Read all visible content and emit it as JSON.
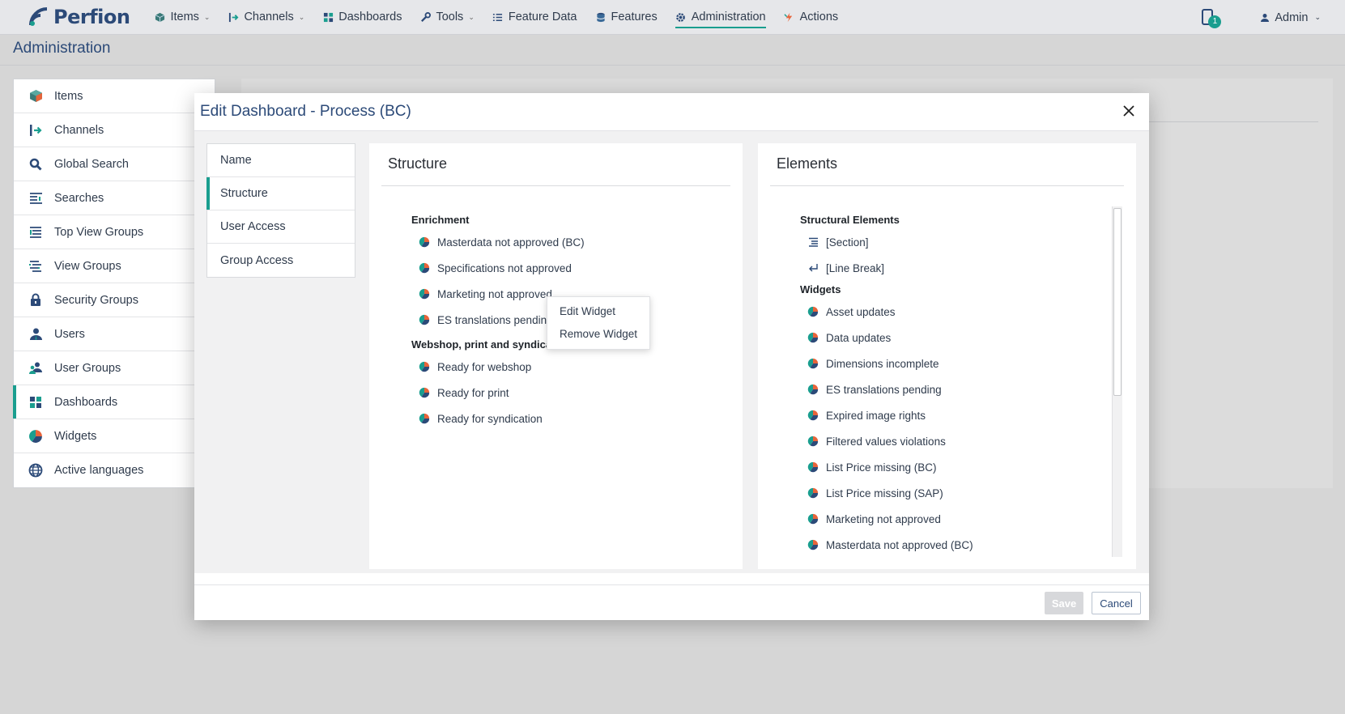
{
  "app": {
    "brand": "Perfion",
    "nav": [
      {
        "label": "Items",
        "icon": "cube-icon",
        "caret": true
      },
      {
        "label": "Channels",
        "icon": "channel-icon",
        "caret": true
      },
      {
        "label": "Dashboards",
        "icon": "dashboard-icon",
        "caret": false
      },
      {
        "label": "Tools",
        "icon": "wrench-icon",
        "caret": true
      },
      {
        "label": "Feature Data",
        "icon": "list-icon",
        "caret": false
      },
      {
        "label": "Features",
        "icon": "database-icon",
        "caret": false
      },
      {
        "label": "Administration",
        "icon": "gear-icon",
        "caret": false,
        "active": true
      },
      {
        "label": "Actions",
        "icon": "lightning-icon",
        "caret": false
      }
    ],
    "notification_count": "1",
    "user_label": "Admin"
  },
  "page": {
    "title": "Administration"
  },
  "sidebar": {
    "items": [
      {
        "label": "Items",
        "icon": "cube-icon"
      },
      {
        "label": "Channels",
        "icon": "channel-icon"
      },
      {
        "label": "Global Search",
        "icon": "search-icon"
      },
      {
        "label": "Searches",
        "icon": "searches-icon"
      },
      {
        "label": "Top View Groups",
        "icon": "top-view-groups-icon"
      },
      {
        "label": "View Groups",
        "icon": "view-groups-icon"
      },
      {
        "label": "Security Groups",
        "icon": "lock-icon"
      },
      {
        "label": "Users",
        "icon": "user-icon"
      },
      {
        "label": "User Groups",
        "icon": "user-group-icon"
      },
      {
        "label": "Dashboards",
        "icon": "dashboard-icon",
        "active": true
      },
      {
        "label": "Widgets",
        "icon": "pie-chart-icon"
      },
      {
        "label": "Active languages",
        "icon": "globe-icon"
      }
    ]
  },
  "modal": {
    "title": "Edit Dashboard - Process (BC)",
    "tabs": [
      {
        "label": "Name"
      },
      {
        "label": "Structure",
        "active": true
      },
      {
        "label": "User Access"
      },
      {
        "label": "Group Access"
      }
    ],
    "structure": {
      "title": "Structure",
      "groups": [
        {
          "label": "Enrichment",
          "items": [
            "Masterdata not approved (BC)",
            "Specifications not approved",
            "Marketing not approved",
            "ES translations pending"
          ]
        },
        {
          "label": "Webshop, print and syndication",
          "items": [
            "Ready for webshop",
            "Ready for print",
            "Ready for syndication"
          ]
        }
      ]
    },
    "elements": {
      "title": "Elements",
      "structural_label": "Structural Elements",
      "structural_items": [
        {
          "label": "[Section]",
          "icon": "section-icon"
        },
        {
          "label": "[Line Break]",
          "icon": "line-break-icon"
        }
      ],
      "widgets_label": "Widgets",
      "widgets": [
        "Asset updates",
        "Data updates",
        "Dimensions incomplete",
        "ES translations pending",
        "Expired image rights",
        "Filtered values violations",
        "List Price missing (BC)",
        "List Price missing (SAP)",
        "Marketing not approved",
        "Masterdata not approved (BC)"
      ]
    },
    "context_menu": [
      "Edit Widget",
      "Remove Widget"
    ],
    "save_label": "Save",
    "cancel_label": "Cancel"
  },
  "colors": {
    "accent": "#1a9e8f",
    "brand": "#2c4a78"
  }
}
